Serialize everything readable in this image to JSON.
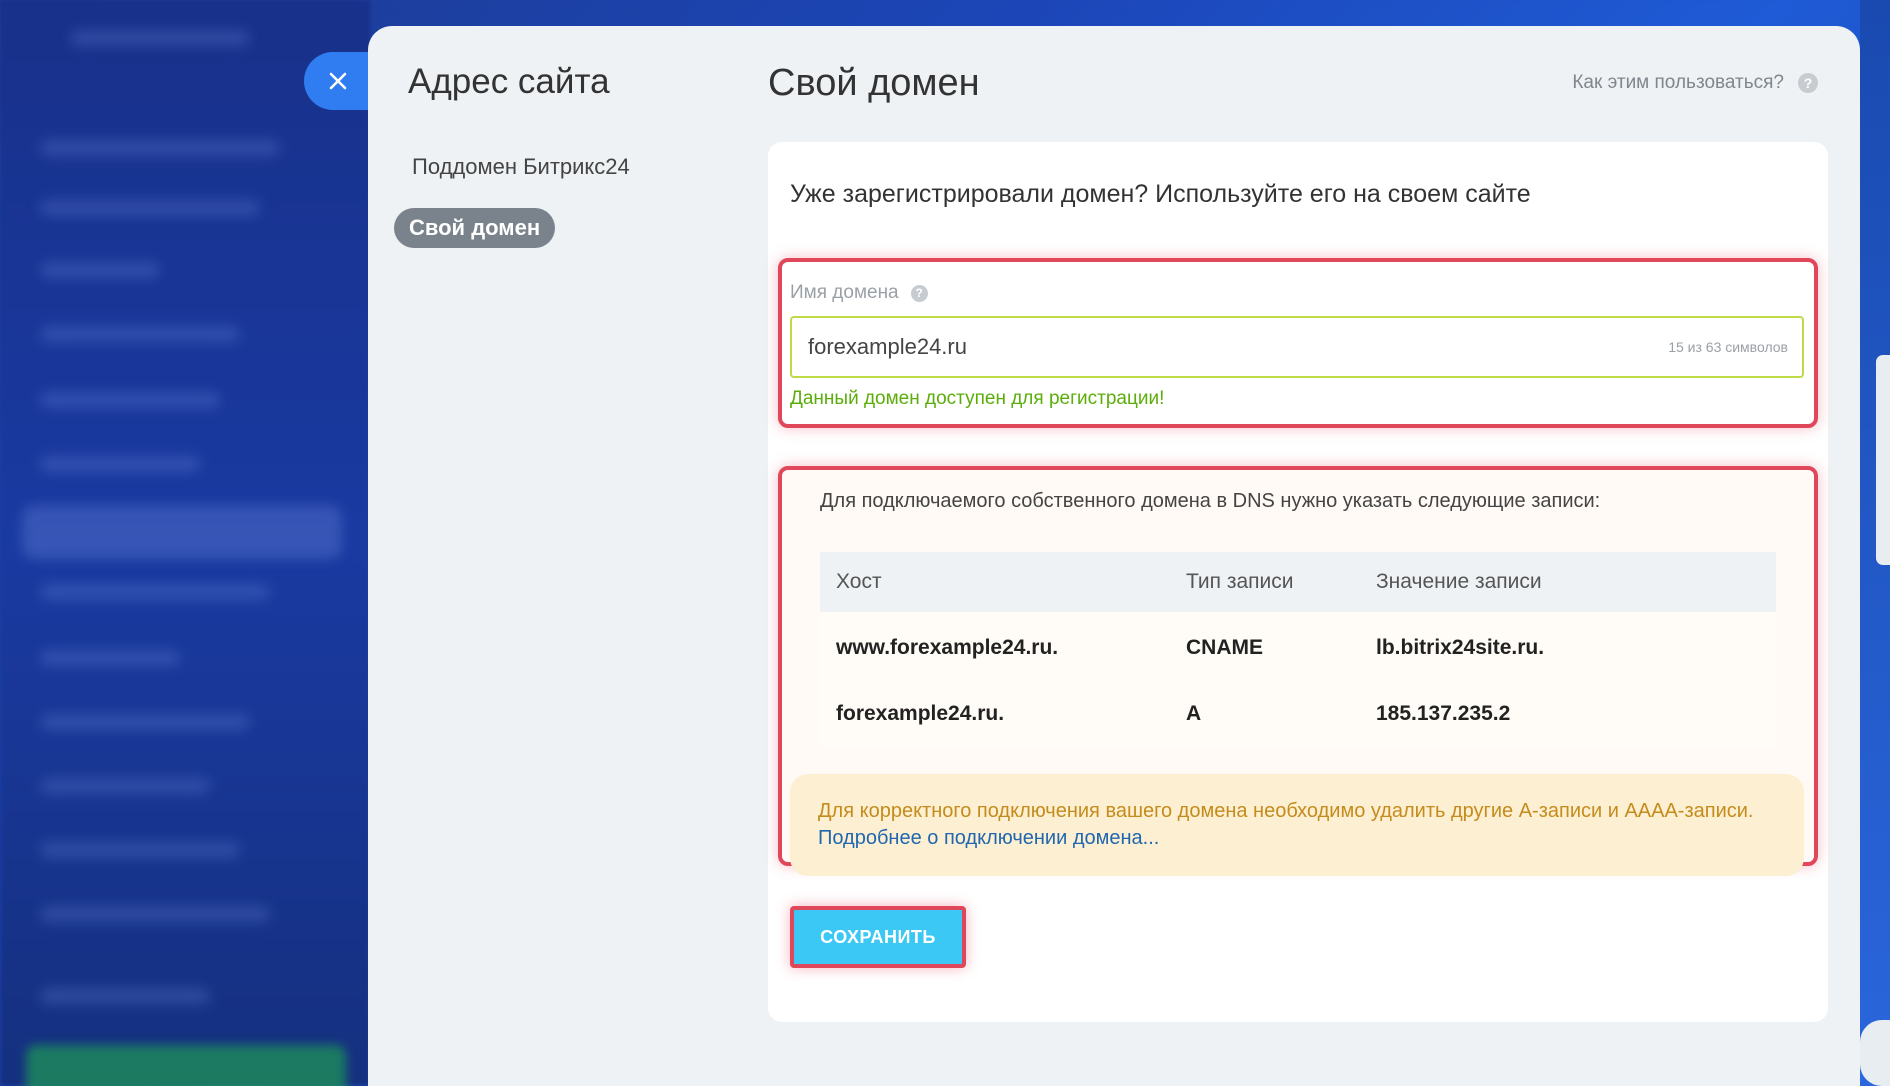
{
  "nav": {
    "title": "Адрес сайта",
    "items": [
      {
        "label": "Поддомен Битрикс24",
        "active": false
      },
      {
        "label": "Свой домен",
        "active": true
      }
    ]
  },
  "header": {
    "title": "Свой домен",
    "help_label": "Как этим пользоваться?",
    "help_icon": "?"
  },
  "form": {
    "heading": "Уже зарегистрировали домен? Используйте его на своем сайте",
    "domain_label": "Имя домена",
    "domain_help_icon": "?",
    "domain_value": "forexample24.ru",
    "domain_counter": "15 из 63 символов",
    "domain_status": "Данный домен доступен для регистрации!"
  },
  "dns": {
    "intro": "Для подключаемого собственного домена в DNS нужно указать следующие записи:",
    "columns": [
      "Хост",
      "Тип записи",
      "Значение записи"
    ],
    "rows": [
      [
        "www.forexample24.ru.",
        "CNAME",
        "lb.bitrix24site.ru."
      ],
      [
        "forexample24.ru.",
        "A",
        "185.137.235.2"
      ]
    ]
  },
  "warning": {
    "text": "Для корректного подключения вашего домена необходимо удалить другие А-записи и АААА-записи. ",
    "link": "Подробнее о подключении домена..."
  },
  "actions": {
    "save_label": "СОХРАНИТЬ"
  },
  "colors": {
    "accent": "#3bc8f5",
    "close": "#2f7df0",
    "success": "#5bad0a",
    "highlight": "#e0475b"
  }
}
